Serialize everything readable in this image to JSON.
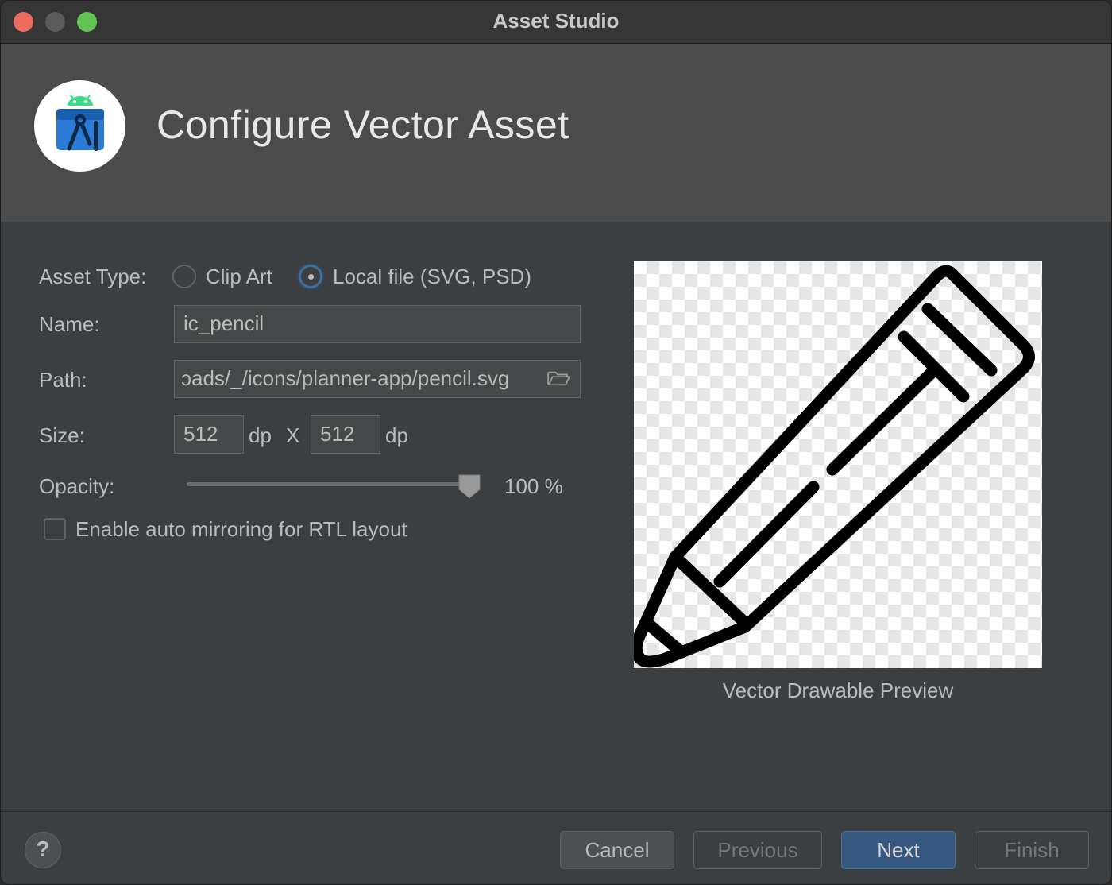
{
  "window": {
    "title": "Asset Studio"
  },
  "header": {
    "title": "Configure Vector Asset",
    "logo_icon": "android-studio-icon"
  },
  "form": {
    "asset_type": {
      "label": "Asset Type:",
      "options": [
        {
          "label": "Clip Art",
          "selected": false
        },
        {
          "label": "Local file (SVG, PSD)",
          "selected": true
        }
      ]
    },
    "name": {
      "label": "Name:",
      "value": "ic_pencil"
    },
    "path": {
      "label": "Path:",
      "value": "ɔads/_/icons/planner-app/pencil.svg",
      "icon": "folder-icon"
    },
    "size": {
      "label": "Size:",
      "width": "512",
      "height": "512",
      "unit": "dp",
      "separator": "X"
    },
    "opacity": {
      "label": "Opacity:",
      "value": 100,
      "display": "100 %"
    },
    "auto_mirror": {
      "label": "Enable auto mirroring for RTL layout",
      "checked": false
    }
  },
  "preview": {
    "caption": "Vector Drawable Preview",
    "icon": "pencil-icon"
  },
  "footer": {
    "help_label": "?",
    "buttons": {
      "cancel": "Cancel",
      "previous": "Previous",
      "next": "Next",
      "finish": "Finish"
    }
  }
}
